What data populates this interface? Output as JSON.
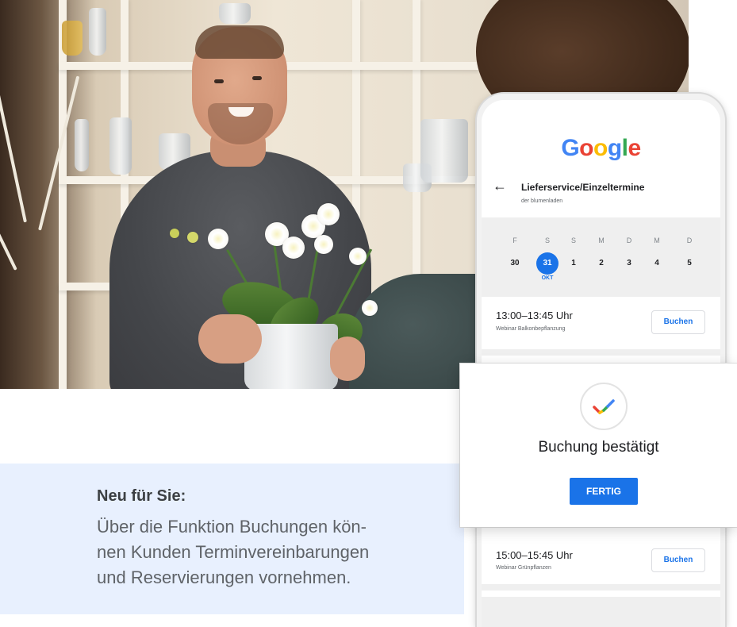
{
  "info": {
    "title": "Neu für Sie:",
    "lines": [
      "Über die Funktion Buchungen kön-",
      "nen Kunden Terminvereinbarungen",
      "und Reservierungen vornehmen."
    ]
  },
  "phone": {
    "logo_letters": [
      "G",
      "o",
      "o",
      "g",
      "l",
      "e"
    ],
    "service_title": "Lieferservice/Einzeltermine",
    "service_subtitle": "der blumenladen",
    "calendar": {
      "weekdays": [
        "F",
        "S",
        "S",
        "M",
        "D",
        "M",
        "D"
      ],
      "days": [
        "30",
        "31",
        "1",
        "2",
        "3",
        "4",
        "5"
      ],
      "selected_index": 1,
      "month": "OKT"
    },
    "slots": [
      {
        "time": "13:00–13:45 Uhr",
        "desc": "Webinar Balkonbepflanzung",
        "button": "Buchen"
      },
      {
        "time": "15:00–15:45 Uhr",
        "desc": "Webinar Grünpflanzen",
        "button": "Buchen"
      }
    ]
  },
  "dialog": {
    "title": "Buchung bestätigt",
    "button": "FERTIG",
    "icon": "checkmark-icon",
    "check_colors": [
      "#ea4335",
      "#fbbc05",
      "#34a853",
      "#4285f4"
    ]
  },
  "colors": {
    "accent": "#1a73e8",
    "info_bg": "#e8f0fe"
  }
}
